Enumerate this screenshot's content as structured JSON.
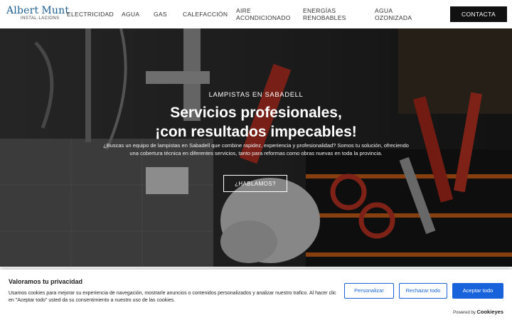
{
  "header": {
    "logo": {
      "line1_first": "Albert",
      "line1_second": "Munt",
      "line2": "INSTAL·LACIONS"
    },
    "nav": [
      {
        "label": "ELECTRICIDAD"
      },
      {
        "label": "AGUA"
      },
      {
        "label": "GAS"
      },
      {
        "label": "CALEFACCIÓN"
      },
      {
        "line1": "AIRE",
        "line2": "ACONDICIONADO"
      },
      {
        "line1": "ENERGÍAS",
        "line2": "RENOBABLES"
      },
      {
        "line1": "AGUA",
        "line2": "OZONIZADA"
      }
    ],
    "cta_label": "CONTACTA"
  },
  "hero": {
    "eyebrow": "LAMPISTAS EN SABADELL",
    "title_line1": "Servicios profesionales,",
    "title_line2": "¡con resultados impecables!",
    "description": "¿Buscas un equipo de lampistas en Sabadell que combine rapidez, experiencia y profesionalidad? Somos tu solución, ofreciendo una cobertura técnica en diferentes servicios, tanto para reformas como obras nuevas en toda la provincia.",
    "button_label": "¿HABLAMOS?"
  },
  "cookie_banner": {
    "title": "Valoramos tu privacidad",
    "text": "Usamos cookies para mejorar su experiencia de navegación, mostrarle anuncios o contenidos personalizados y analizar nuestro trafico. Al hacer clic en \"Aceptar todo\" usted da su consentimiento a nuestro uso de las cookies.",
    "customize_label": "Personalizar",
    "reject_label": "Rechazar todo",
    "accept_label": "Aceptar todo",
    "powered_by": "Powered by",
    "brand": "Cookieyes"
  },
  "colors": {
    "logo_blue": "#1d5d8f",
    "cookie_blue": "#1863dc",
    "cta_background": "#111111"
  }
}
